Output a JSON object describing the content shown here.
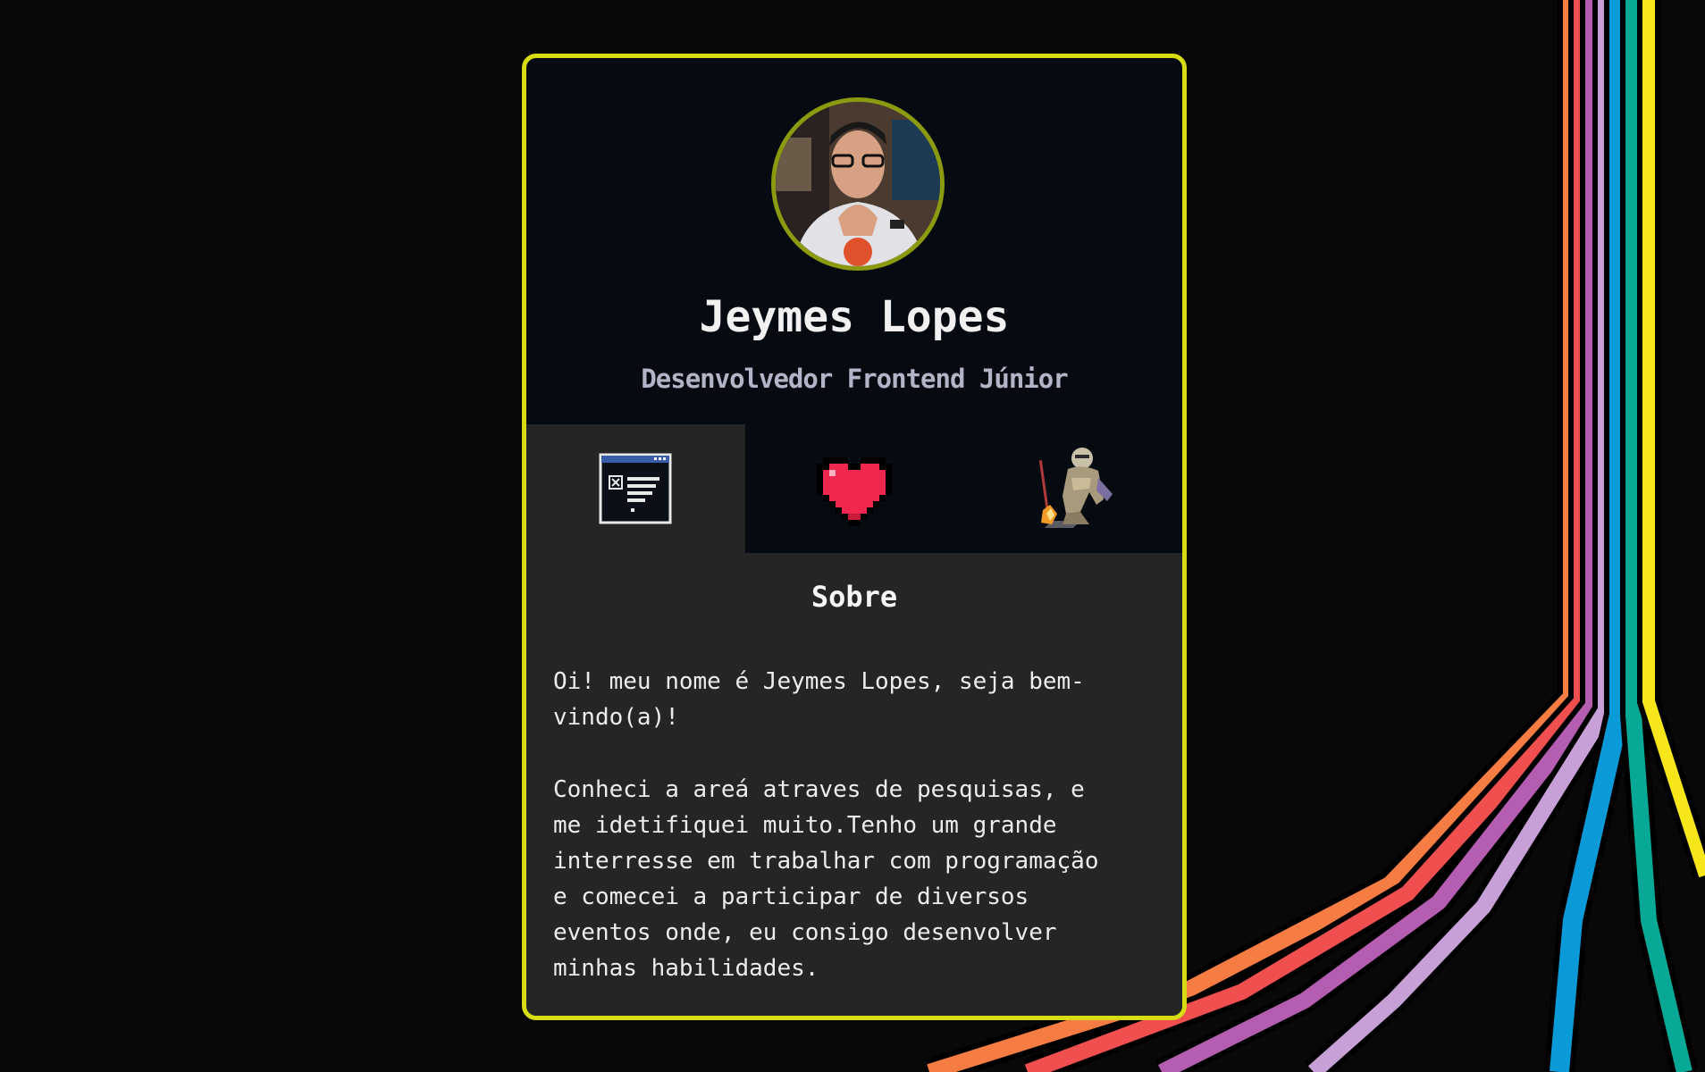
{
  "profile": {
    "name": "Jeymes Lopes",
    "role": "Desenvolvedor Frontend Júnior",
    "avatar_icon": "profile-photo"
  },
  "tabs": [
    {
      "icon": "browser-window-icon",
      "active": true
    },
    {
      "icon": "pixel-heart-icon",
      "active": false
    },
    {
      "icon": "knight-bonfire-icon",
      "active": false
    }
  ],
  "about": {
    "title": "Sobre",
    "paragraph_1": "Oi! meu nome é Jeymes Lopes, seja bem-\nvindo(a)!",
    "paragraph_2": "Conheci a areá atraves de pesquisas, e\nme idetifiquei muito.Tenho um grande\ninterresse em trabalhar com programação\ne comecei a participar de diversos\neventos onde, eu consigo desenvolver\nminhas habilidades."
  },
  "colors": {
    "background": "#080808",
    "card_border": "#d7dd12",
    "card_header": "#060b11",
    "panel": "#252525",
    "heart": "#f0274f",
    "stripes": [
      "#f57c42",
      "#ef4f4f",
      "#b45db1",
      "#c7a0d8",
      "#0a9ad8",
      "#08a896",
      "#f7e61a"
    ]
  }
}
